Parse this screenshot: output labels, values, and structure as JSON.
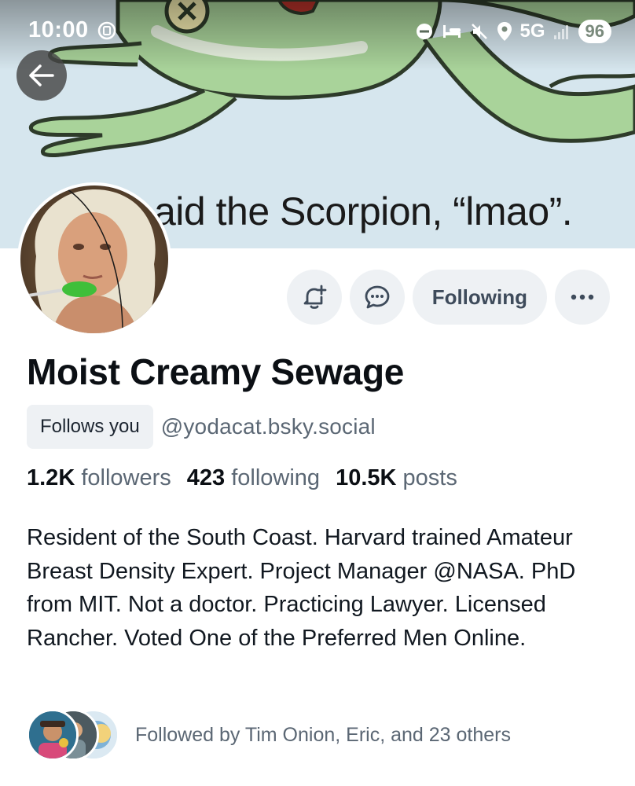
{
  "status_bar": {
    "time": "10:00",
    "network": "5G",
    "battery": "96"
  },
  "banner": {
    "caption": "aid the Scorpion, “lmao”."
  },
  "actions": {
    "following_label": "Following"
  },
  "profile": {
    "display_name": "Moist Creamy Sewage",
    "follows_you_label": "Follows you",
    "handle": "@yodacat.bsky.social",
    "stats": [
      {
        "value": "1.2K",
        "label": "followers"
      },
      {
        "value": "423",
        "label": "following"
      },
      {
        "value": "10.5K",
        "label": "posts"
      }
    ],
    "bio": "Resident of the South Coast. Harvard trained Amateur Breast Density Expert. Project Manager @NASA. PhD from MIT. Not a doctor. Practicing Lawyer. Licensed Rancher. Voted One of the Preferred Men Online.",
    "followed_by": "Followed by Tim Onion, Eric, and 23 others"
  },
  "colors": {
    "accent_button_bg": "#eef1f4",
    "muted_text": "#5b6774",
    "banner_bg": "#d6e6ee",
    "frog_green": "#a9d39a"
  }
}
